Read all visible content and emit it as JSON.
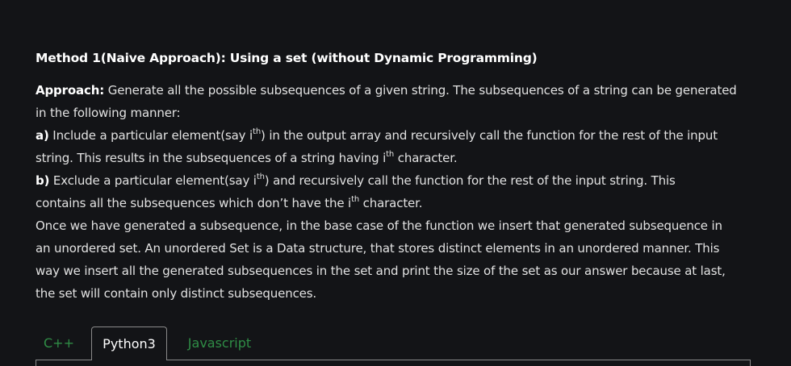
{
  "article": {
    "heading": "Method 1(Naive Approach): Using a set (without Dynamic Programming)",
    "approach_label": "Approach:",
    "approach_line1": " Generate all the possible subsequences of a given string. The subsequences of a string can be generated",
    "approach_line2": "in the following manner:",
    "a_label": "a)",
    "a_line1_pre": " Include a particular element(say i",
    "a_sup": "th",
    "a_line1_post": ") in the output array and recursively call the function for the rest of the input",
    "a_line2_pre": "string. This results in the subsequences of a string having i",
    "a_line2_sup": "th",
    "a_line2_post": " character.",
    "b_label": "b)",
    "b_line1_pre": " Exclude a particular element(say i",
    "b_sup": "th",
    "b_line1_post": ") and recursively call the function for the rest of the input string. This",
    "b_line2_pre": "contains all the subsequences which don’t have the i",
    "b_line2_sup": "th",
    "b_line2_post": " character.",
    "para_line1": "Once we have generated a subsequence, in the base case of the function we insert that generated subsequence in",
    "para_line2": "an unordered set. An unordered Set is a Data structure, that stores distinct elements in an unordered manner. This",
    "para_line3": "way we insert all the generated subsequences in the set and print the size of the set as our answer because at last,",
    "para_line4": "the set will contain only distinct subsequences."
  },
  "tabs": {
    "items": [
      {
        "label": "C++"
      },
      {
        "label": "Python3"
      },
      {
        "label": "Javascript"
      }
    ],
    "active": "Python3"
  },
  "colors": {
    "background": "#131417",
    "tab_inactive": "#2f8d46",
    "tab_active_text": "#ffffff",
    "border": "#8a8a8a"
  }
}
